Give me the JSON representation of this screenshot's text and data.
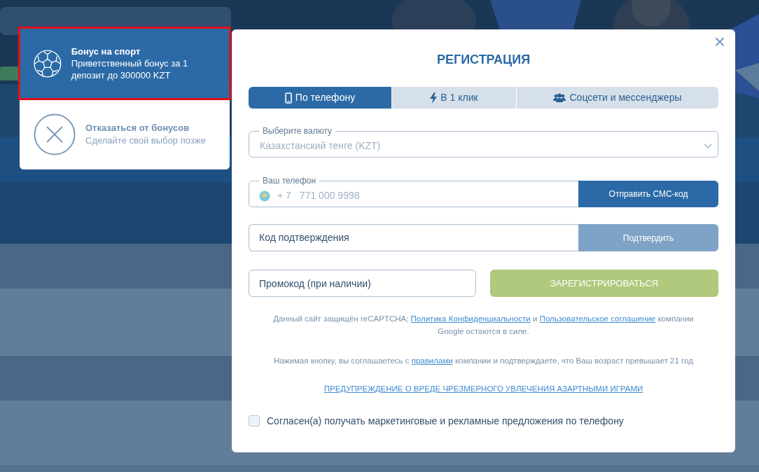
{
  "bonus_options": [
    {
      "kind": "sport",
      "title": "Бонус на спорт",
      "subtitle": "Приветственный бонус за 1 депозит до 300000 KZT",
      "selected": true
    },
    {
      "kind": "decline",
      "title": "Отказаться от бонусов",
      "subtitle": "Сделайте свой выбор позже",
      "selected": false
    }
  ],
  "registration": {
    "title": "РЕГИСТРАЦИЯ",
    "close": "×",
    "tabs": [
      {
        "kind": "phone",
        "label": "По телефону",
        "selected": true
      },
      {
        "kind": "oneclick",
        "label": "В 1 клик",
        "selected": false
      },
      {
        "kind": "social",
        "label": "Соцсети и мессенджеры",
        "selected": false
      }
    ],
    "currency": {
      "label": "Выберите валюту",
      "value": "Казахстанский тенге (KZT)"
    },
    "phone": {
      "label": "Ваш телефон",
      "prefix": "+ 7",
      "placeholder": "771 000 9998",
      "button": "Отправить СМС-код"
    },
    "code": {
      "placeholder": "Код подтверждения",
      "button": "Подтвердить",
      "disabled": true
    },
    "promo": {
      "placeholder": "Промокод (при наличии)"
    },
    "register": {
      "label": "ЗАРЕГИСТРИРОВАТЬСЯ",
      "disabled": true
    },
    "captcha_note": [
      {
        "kind": "text",
        "text": "Данный сайт защищён reCAPTCHA; "
      },
      {
        "kind": "link",
        "text": "Политика Конфиденциальности"
      },
      {
        "kind": "text",
        "text": " и "
      },
      {
        "kind": "link",
        "text": "Пользовательское соглашение"
      },
      {
        "kind": "text",
        "text": " компании Google остаются в силе."
      }
    ],
    "age_note": [
      {
        "kind": "text",
        "text": "Нажимая кнопку, вы соглашаетесь с "
      },
      {
        "kind": "link",
        "text": "правилами"
      },
      {
        "kind": "text",
        "text": " компании и подтверждаете, что Ваш возраст превышает 21 год"
      }
    ],
    "warning_link": "ПРЕДУПРЕЖДЕНИЕ О ВРЕДЕ ЧРЕЗМЕРНОГО УВЛЕЧЕНИЯ АЗАРТНЫМИ ИГРАМИ",
    "marketing": {
      "label": "Согласен(а) получать маркетинговые и рекламные предложения по телефону",
      "checked": false
    }
  }
}
